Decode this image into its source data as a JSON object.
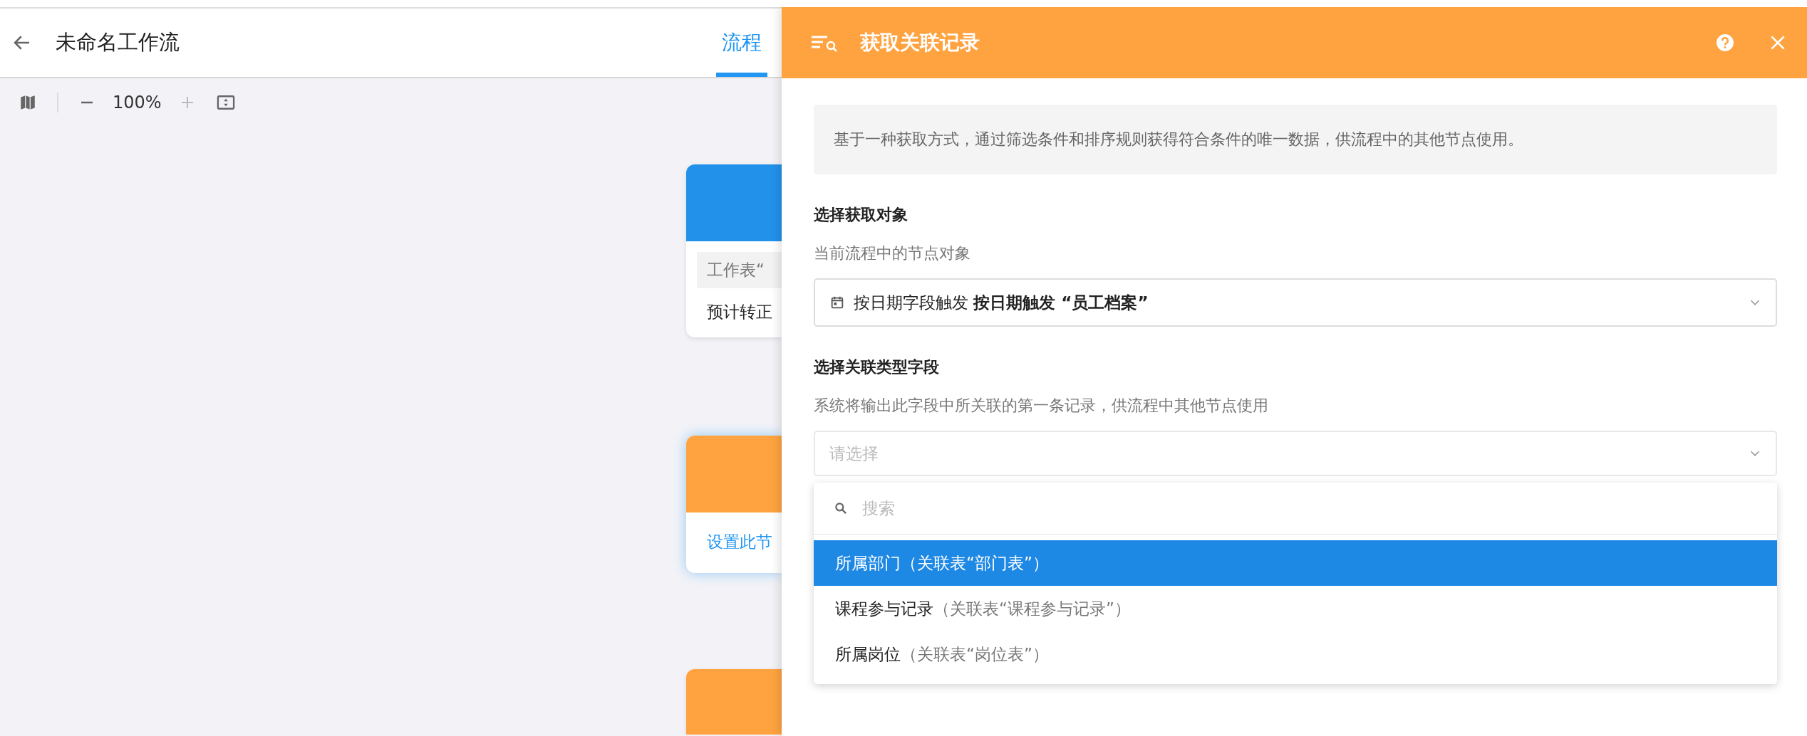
{
  "header": {
    "title": "未命名工作流",
    "tabs": [
      {
        "label": "流程",
        "selected": true
      }
    ]
  },
  "toolbar": {
    "zoom": "100%"
  },
  "canvas": {
    "nodes": [
      {
        "kind": "trigger",
        "selected": false,
        "source": "工作表“",
        "detail": "预计转正"
      },
      {
        "kind": "action",
        "selected": true,
        "hint": "设置此节"
      },
      {
        "kind": "action",
        "selected": false
      }
    ]
  },
  "panel": {
    "title": "获取关联记录",
    "description": "基于一种获取方式，通过筛选条件和排序规则获得符合条件的唯一数据，供流程中的其他节点使用。",
    "sections": [
      {
        "heading": "选择获取对象",
        "hint": "当前流程中的节点对象",
        "value": "按日期字段触发 **按日期触发 “员工档案”**"
      },
      {
        "heading": "选择关联类型字段",
        "hint": "系统将输出此字段中所关联的第一条记录，供流程中其他节点使用",
        "placeholder": "请选择",
        "expanded": true
      }
    ],
    "dropdown": {
      "search_placeholder": "搜索",
      "options": [
        {
          "name": "所属部门",
          "detail": "（关联表“部门表”）",
          "selected": true
        },
        {
          "name": "课程参与记录",
          "detail": "（关联表“课程参与记录”）",
          "selected": false
        },
        {
          "name": "所属岗位",
          "detail": "（关联表“岗位表”）",
          "selected": false
        }
      ]
    }
  }
}
